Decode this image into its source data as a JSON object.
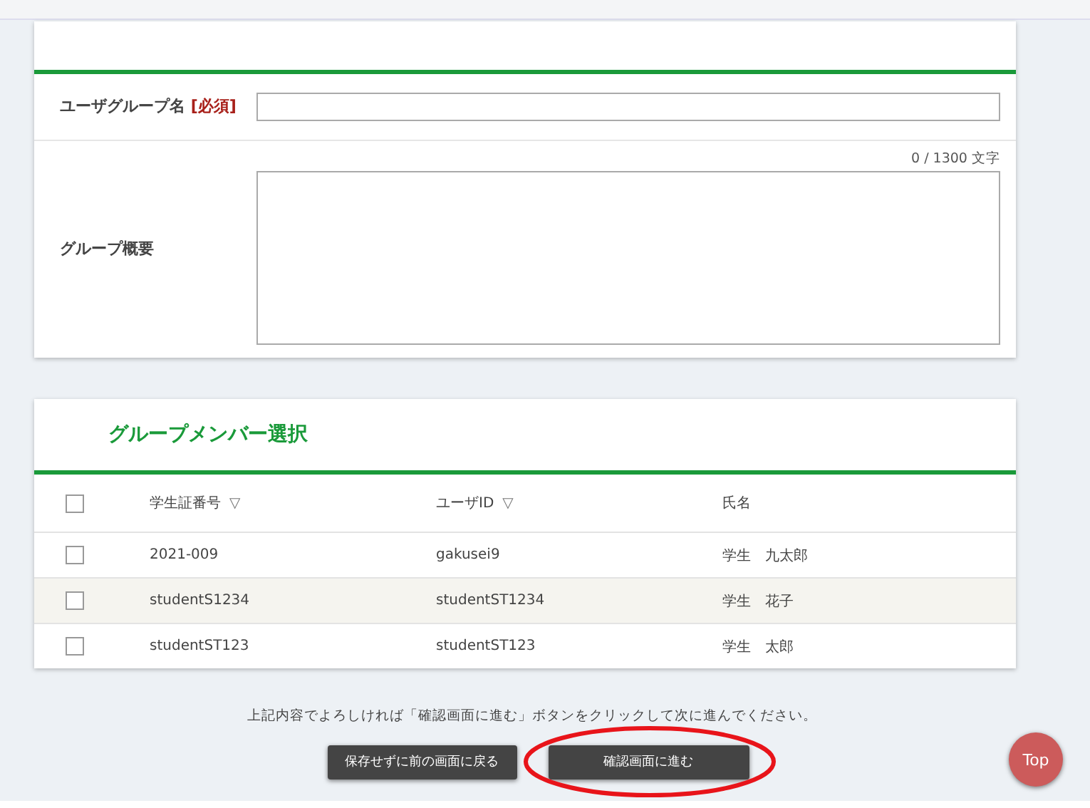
{
  "group_form": {
    "fields": [
      {
        "kind": "input",
        "label": "ユーザグループ名",
        "required": "[必須]"
      },
      {
        "kind": "textarea",
        "label": "グループ概要",
        "counter": "0 / 1300 文字"
      }
    ]
  },
  "members": {
    "title": "グループメンバー選択",
    "select_all": {
      "checked": false
    },
    "columns": [
      {
        "label": "学生証番号",
        "sort_icon": "▽"
      },
      {
        "label": "ユーザID",
        "sort_icon": "▽"
      },
      {
        "label": "氏名"
      }
    ],
    "rows": [
      {
        "checked": false,
        "highlighted": false,
        "cells": [
          "2021-009",
          "gakusei9",
          "学生　九太郎"
        ]
      },
      {
        "checked": false,
        "highlighted": true,
        "cells": [
          "studentS1234",
          "studentST1234",
          "学生　花子"
        ]
      },
      {
        "checked": false,
        "highlighted": false,
        "cells": [
          "studentST123",
          "studentST123",
          "学生　太郎"
        ]
      }
    ]
  },
  "instruction": "上記内容でよろしければ「確認画面に進む」ボタンをクリックして次に進んでください。",
  "buttons": [
    {
      "label": "保存せずに前の画面に戻る",
      "circled": false
    },
    {
      "label": "確認画面に進む",
      "circled": true
    }
  ],
  "top_button": "Top"
}
